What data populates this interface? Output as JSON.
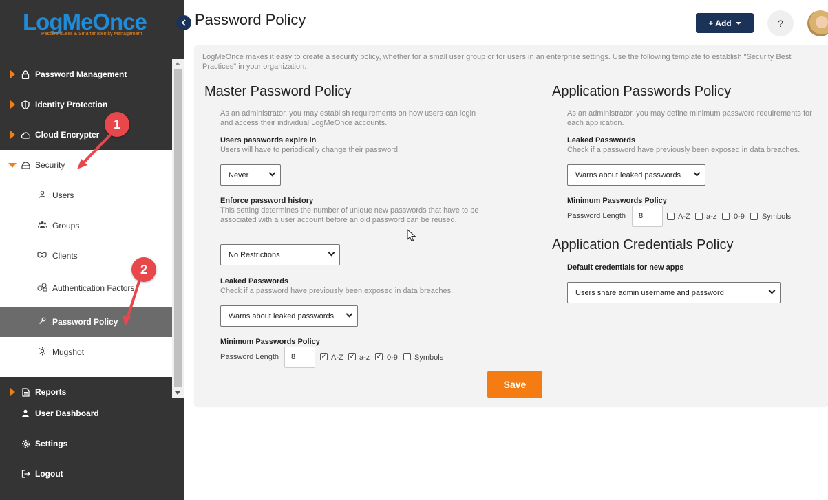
{
  "app": {
    "logo_text": "LogMeOnce",
    "logo_tagline": "PasswordLess & Smarter Identity Management",
    "collapse_icon": "chevron-left-icon"
  },
  "sidebar": {
    "items": [
      {
        "label": "Password Management",
        "icon": "lock-icon"
      },
      {
        "label": "Identity Protection",
        "icon": "shield-icon"
      },
      {
        "label": "Cloud Encrypter",
        "icon": "cloud-icon"
      },
      {
        "label": "Security",
        "icon": "security-icon"
      },
      {
        "label": "Reports",
        "icon": "document-icon"
      },
      {
        "label": "User Dashboard",
        "icon": "user-icon"
      },
      {
        "label": "Settings",
        "icon": "gear-icon"
      },
      {
        "label": "Logout",
        "icon": "logout-icon"
      }
    ],
    "security_subitems": [
      {
        "label": "Users",
        "icon": "user-icon"
      },
      {
        "label": "Groups",
        "icon": "group-icon"
      },
      {
        "label": "Clients",
        "icon": "handshake-icon"
      },
      {
        "label": "Authentication Factors",
        "icon": "factors-icon"
      },
      {
        "label": "Password Policy",
        "icon": "key-icon"
      },
      {
        "label": "Mugshot",
        "icon": "mugshot-icon"
      }
    ],
    "callouts": [
      "1",
      "2"
    ]
  },
  "header": {
    "title": "Password Policy",
    "add_label": "+ Add",
    "help_label": "?"
  },
  "intro": "LogMeOnce makes it easy to create a security policy, whether for a small user group or for users in an enterprise settings. Use the following template to establish \"Security Best Practices\" in your organization.",
  "master": {
    "title": "Master Password Policy",
    "description": "As an administrator, you may establish requirements on how users can login and access their individual LogMeOnce accounts.",
    "expire_label": "Users passwords expire in",
    "expire_desc": "Users will have to periodically change their password.",
    "expire_value": "Never",
    "history_label": "Enforce password history",
    "history_desc": "This setting determines the number of unique new passwords that have to be associated with a user account before an old password can be reused.",
    "history_value": "No Restrictions",
    "leaked_label": "Leaked Passwords",
    "leaked_desc": "Check if a password have previously been exposed in data breaches.",
    "leaked_value": "Warns about leaked passwords",
    "min_label": "Minimum Passwords Policy",
    "length_label": "Password Length",
    "length_value": "8",
    "opt_az_upper": "A-Z",
    "opt_az_lower": "a-z",
    "opt_digits": "0-9",
    "opt_symbols": "Symbols",
    "checked": {
      "upper": true,
      "lower": true,
      "digits": true,
      "symbols": false
    }
  },
  "application": {
    "title": "Application Passwords Policy",
    "description": "As an administrator, you may define minimum password requirements for each application.",
    "leaked_label": "Leaked Passwords",
    "leaked_desc": "Check if a password have previously been exposed in data breaches.",
    "leaked_value": "Warns about leaked passwords",
    "min_label": "Minimum Passwords Policy",
    "length_label": "Password Length",
    "length_value": "8",
    "opt_az_upper": "A-Z",
    "opt_az_lower": "a-z",
    "opt_digits": "0-9",
    "opt_symbols": "Symbols",
    "checked": {
      "upper": false,
      "lower": false,
      "digits": false,
      "symbols": false
    }
  },
  "credentials": {
    "title": "Application Credentials Policy",
    "default_label": "Default credentials for new apps",
    "default_value": "Users share admin username and password"
  },
  "save_label": "Save",
  "colors": {
    "sidebar_bg": "#343434",
    "accent_orange": "#f47c12",
    "navy": "#1b3358",
    "callout_red": "#e8474c"
  }
}
